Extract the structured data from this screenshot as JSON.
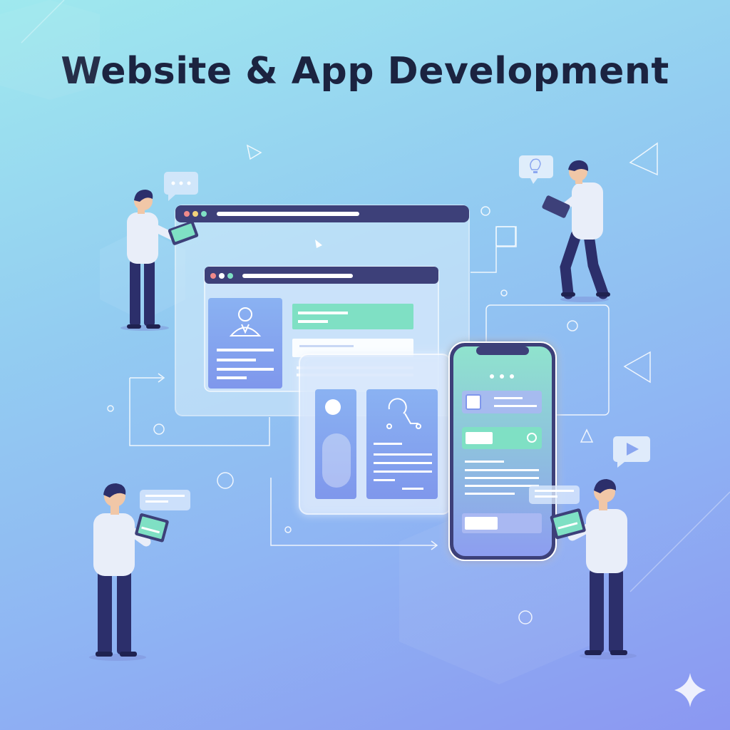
{
  "title": "Website & App Development",
  "colors": {
    "navy": "#3d4079",
    "teal": "#7fe0c4",
    "card_blue": "#8aa6f0",
    "figure_shirt": "#e9eef9",
    "figure_pants": "#2c2f6b",
    "title_text": "#1b2340"
  },
  "icons": [
    "user-profile-icon",
    "lightbulb-icon",
    "play-icon",
    "chat-dots-icon",
    "sync-icon",
    "sparkle-icon"
  ]
}
